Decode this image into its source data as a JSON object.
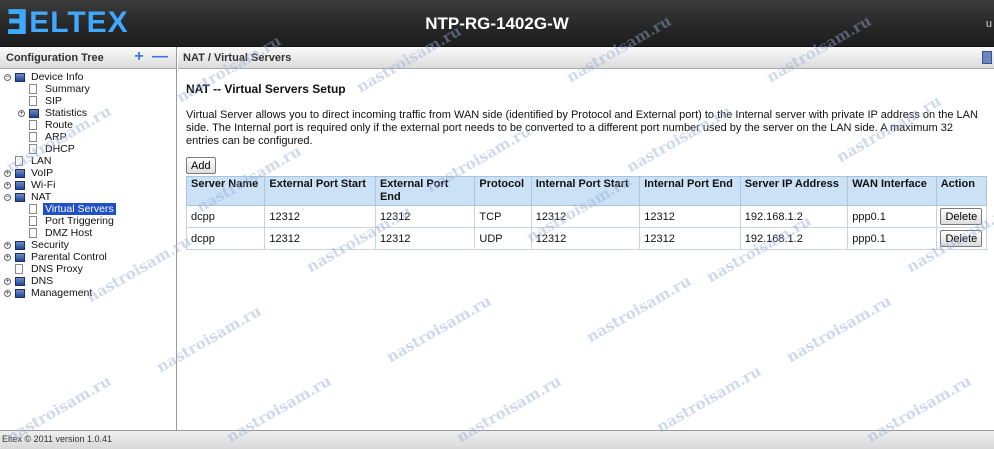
{
  "header": {
    "brand": "ELTEX",
    "device": "NTP-RG-1402G-W",
    "user": "u"
  },
  "sidebar": {
    "title": "Configuration Tree",
    "plus": "+",
    "minus": "—",
    "tree": [
      {
        "label": "Device Info",
        "level": 0,
        "expander": "−",
        "type": "folder"
      },
      {
        "label": "Summary",
        "level": 1,
        "type": "page"
      },
      {
        "label": "SIP",
        "level": 1,
        "type": "page"
      },
      {
        "label": "Statistics",
        "level": 1,
        "expander": "+",
        "type": "folder"
      },
      {
        "label": "Route",
        "level": 1,
        "type": "page"
      },
      {
        "label": "ARP",
        "level": 1,
        "type": "page"
      },
      {
        "label": "DHCP",
        "level": 1,
        "type": "page"
      },
      {
        "label": "LAN",
        "level": 0,
        "type": "page"
      },
      {
        "label": "VoIP",
        "level": 0,
        "expander": "+",
        "type": "folder"
      },
      {
        "label": "Wi-Fi",
        "level": 0,
        "expander": "+",
        "type": "folder"
      },
      {
        "label": "NAT",
        "level": 0,
        "expander": "−",
        "type": "folder"
      },
      {
        "label": "Virtual Servers",
        "level": 1,
        "type": "page",
        "selected": true
      },
      {
        "label": "Port Triggering",
        "level": 1,
        "type": "page"
      },
      {
        "label": "DMZ Host",
        "level": 1,
        "type": "page"
      },
      {
        "label": "Security",
        "level": 0,
        "expander": "+",
        "type": "folder"
      },
      {
        "label": "Parental Control",
        "level": 0,
        "expander": "+",
        "type": "folder"
      },
      {
        "label": "DNS Proxy",
        "level": 0,
        "type": "page"
      },
      {
        "label": "DNS",
        "level": 0,
        "expander": "+",
        "type": "folder"
      },
      {
        "label": "Management",
        "level": 0,
        "expander": "+",
        "type": "folder"
      }
    ]
  },
  "breadcrumb": "NAT / Virtual Servers",
  "page": {
    "title": "NAT -- Virtual Servers Setup",
    "description": "Virtual Server allows you to direct incoming traffic from WAN side (identified by Protocol and External port) to the Internal server with private IP address on the LAN side. The Internal port is required only if the external port needs to be converted to a different port number used by the server on the LAN side. A maximum 32 entries can be configured.",
    "add_label": "Add",
    "columns": [
      "Server Name",
      "External Port Start",
      "External Port End",
      "Protocol",
      "Internal Port Start",
      "Internal Port End",
      "Server IP Address",
      "WAN Interface",
      "Action"
    ],
    "rows": [
      [
        "dcpp",
        "12312",
        "12312",
        "TCP",
        "12312",
        "12312",
        "192.168.1.2",
        "ppp0.1"
      ],
      [
        "dcpp",
        "12312",
        "12312",
        "UDP",
        "12312",
        "12312",
        "192.168.1.2",
        "ppp0.1"
      ]
    ],
    "delete_label": "Delete"
  },
  "footer": "Eltex © 2011 version 1.0.41",
  "watermark": "nastroisam.ru"
}
